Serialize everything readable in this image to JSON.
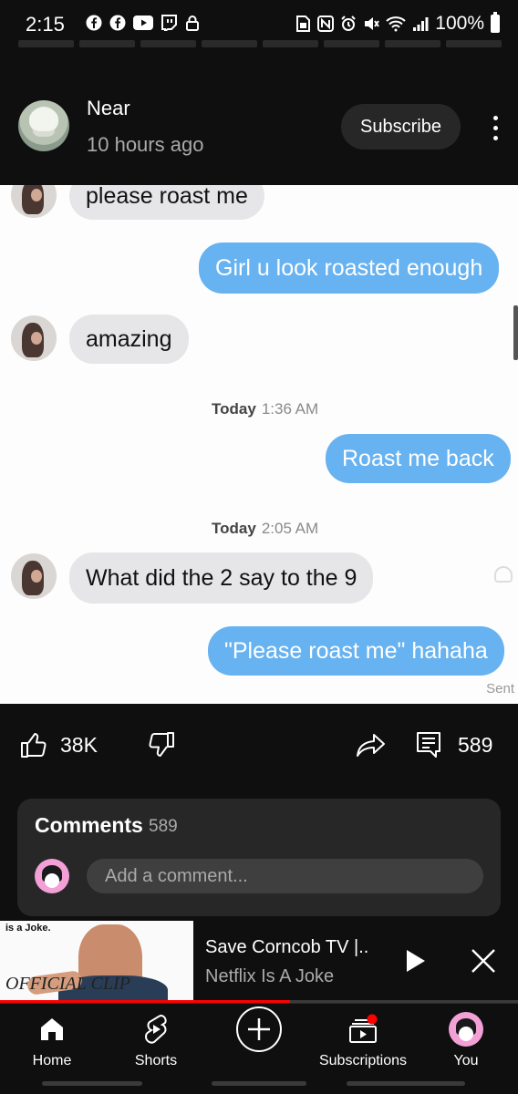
{
  "status_bar": {
    "time": "2:15",
    "battery": "100%",
    "left_icons": [
      "facebook-icon",
      "facebook-icon",
      "youtube-icon",
      "twitch-icon",
      "lock-icon"
    ],
    "right_icons": [
      "sim-icon",
      "nfc-icon",
      "alarm-icon",
      "mute-icon",
      "wifi-icon",
      "signal-icon"
    ]
  },
  "post": {
    "channel_name": "Near",
    "posted_time": "10 hours ago",
    "subscribe_label": "Subscribe"
  },
  "image_chat": {
    "messages": [
      {
        "text": "please roast me",
        "side": "in"
      },
      {
        "text": "Girl u look roasted enough",
        "side": "out"
      },
      {
        "text": "amazing",
        "side": "in"
      },
      {
        "text": "Roast me back",
        "side": "out"
      },
      {
        "text": "What did the 2 say to the 9",
        "side": "in"
      },
      {
        "text": "\"Please roast me\" hahaha",
        "side": "out"
      }
    ],
    "timestamps": [
      {
        "day": "Today",
        "time": "1:36 AM"
      },
      {
        "day": "Today",
        "time": "2:05 AM"
      }
    ],
    "sent_label": "Sent"
  },
  "actions": {
    "likes": "38K",
    "comments": "589"
  },
  "comments_section": {
    "title": "Comments",
    "count": "589",
    "placeholder": "Add a comment..."
  },
  "mini_player": {
    "title": "Save Corncob TV |..",
    "channel": "Netflix Is A Joke",
    "thumb_top_text": "is a Joke.",
    "thumb_label": "OFFICIAL CLIP",
    "progress": 0.56
  },
  "bottom_nav": {
    "items": [
      {
        "label": "Home"
      },
      {
        "label": "Shorts"
      },
      {
        "label": ""
      },
      {
        "label": "Subscriptions"
      },
      {
        "label": "You"
      }
    ]
  },
  "colors": {
    "background": "#0f0f0f",
    "chip": "#272727",
    "muted_text": "#aaaaaa",
    "out_bubble": "#67b2f0",
    "in_bubble": "#e6e6e8",
    "progress": "#ff0000",
    "notification_dot": "#ff0000"
  }
}
